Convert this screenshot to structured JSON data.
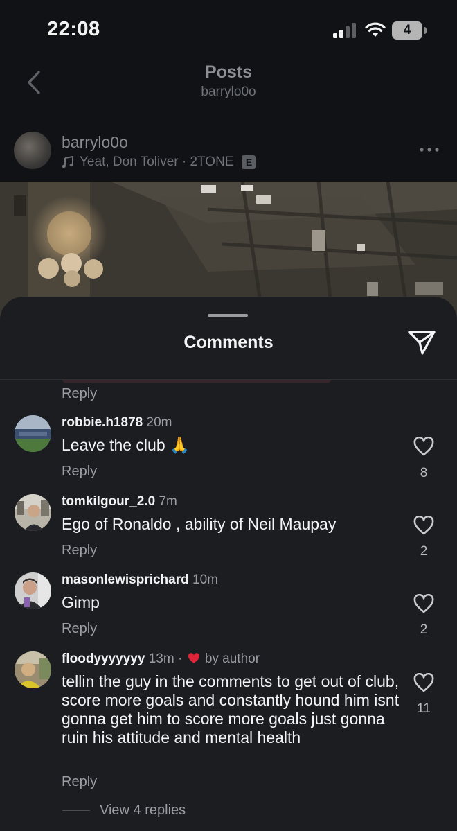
{
  "status_bar": {
    "time": "22:08",
    "battery": "4"
  },
  "nav": {
    "title": "Posts",
    "subtitle": "barrylo0o"
  },
  "post": {
    "username": "barrylo0o",
    "music": "Yeat, Don Toliver · 2TONE",
    "explicit": "E"
  },
  "sheet": {
    "title": "Comments",
    "top_reply": "Reply"
  },
  "comments": [
    {
      "username": "robbie.h1878",
      "time": "20m",
      "text": "Leave the club 🙏",
      "reply": "Reply",
      "likes": "8"
    },
    {
      "username": "tomkilgour_2.0",
      "time": "7m",
      "text": "Ego of Ronaldo , ability of Neil Maupay",
      "reply": "Reply",
      "likes": "2"
    },
    {
      "username": "masonlewisprichard",
      "time": "10m",
      "text": "Gimp",
      "reply": "Reply",
      "likes": "2"
    },
    {
      "username": "floodyyyyyyy",
      "time": "13m",
      "author_tag": "by author",
      "text": "tellin the guy in the comments to get out of club, score more goals and constantly hound him isnt gonna get him to score more goals just gonna ruin his attitude and mental health",
      "reply": "Reply",
      "likes": "11",
      "view_replies": "View 4 replies"
    }
  ],
  "colors": {
    "background": "#0c0e11",
    "sheet": "#1b1d21",
    "heart_red": "#e0243a",
    "muted_text": "#9a9da2"
  },
  "icons": [
    "back-chevron-icon",
    "music-note-icon",
    "more-dots-icon",
    "share-icon",
    "heart-icon",
    "heart-filled-icon"
  ]
}
